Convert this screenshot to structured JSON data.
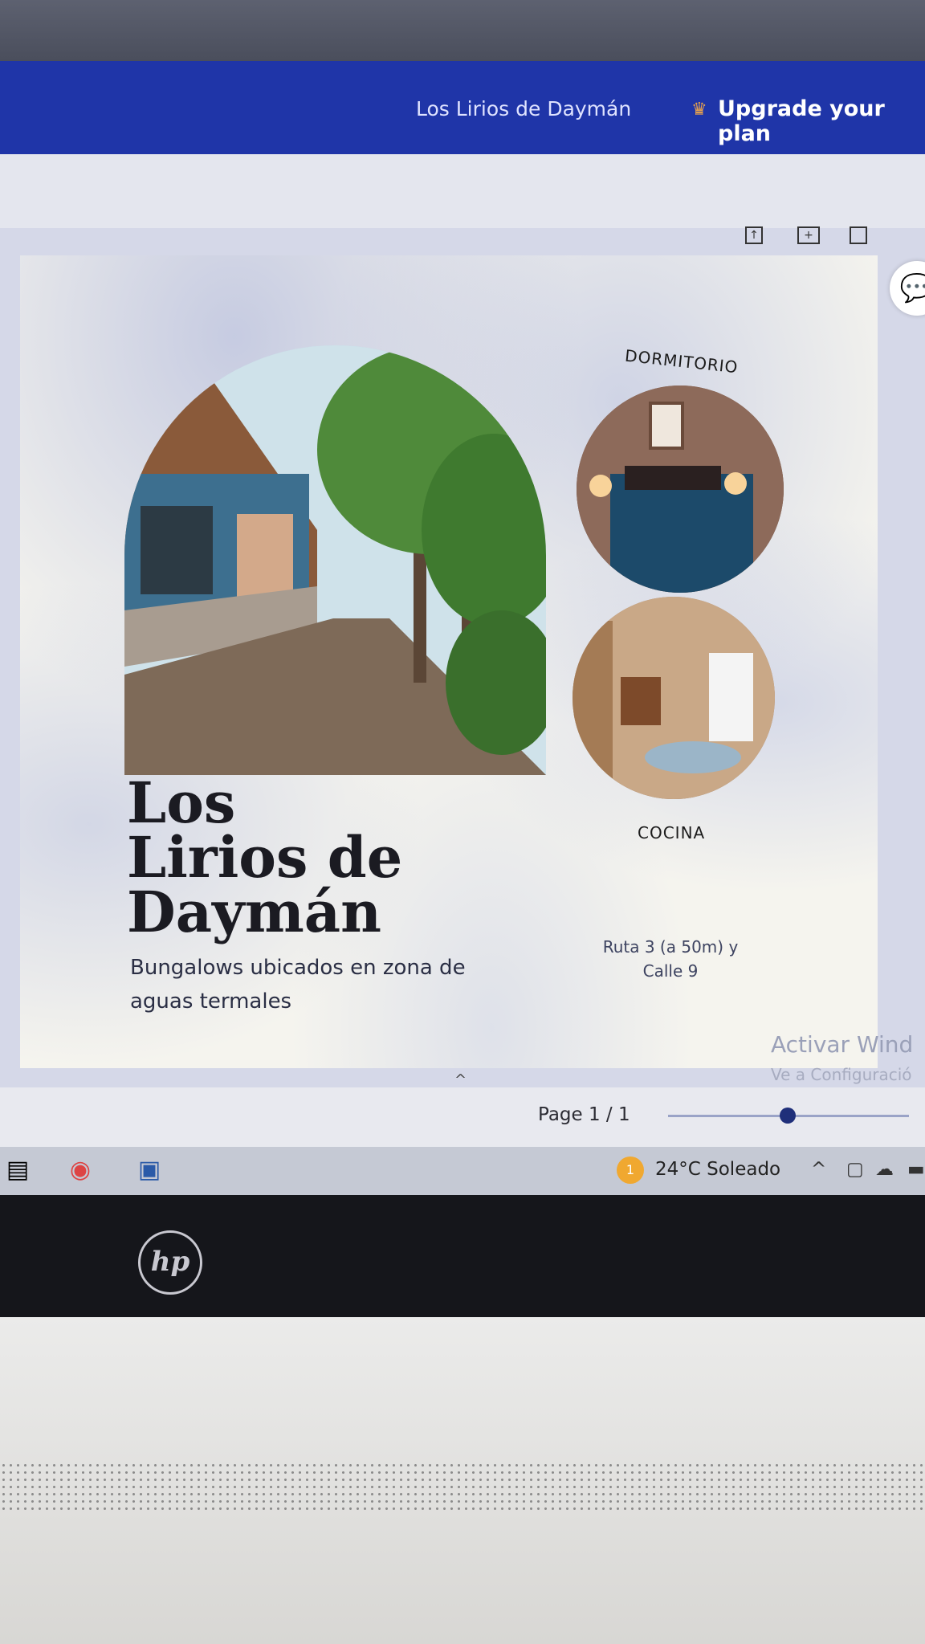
{
  "header": {
    "title": "Los Lirios de Daymán",
    "upgrade_label": "Upgrade your plan",
    "crown_icon": "crown-icon"
  },
  "design": {
    "photo_labels": {
      "bedroom": "DORMITORIO",
      "kitchen": "COCINA"
    },
    "title_lines": [
      "Los",
      "Lirios de",
      "Daymán"
    ],
    "tagline": "Bungalows ubicados en zona de aguas termales",
    "address": "Ruta 3 (a 50m) y Calle 9"
  },
  "windows_activation": {
    "line1": "Activar Wind",
    "line2": "Ve a Configuració"
  },
  "page_nav": {
    "page_label": "Page 1 / 1",
    "zoom_fraction": 0.4
  },
  "taskbar": {
    "weather": "24°C  Soleado",
    "weather_badge": "1",
    "apps": [
      "file-explorer-icon",
      "chrome-icon",
      "app-icon"
    ]
  },
  "laptop": {
    "brand": "hp"
  },
  "colors": {
    "header": "#1f35a8",
    "upgrade_crown": "#e9a24b",
    "design_background": "#f5f4ee"
  }
}
